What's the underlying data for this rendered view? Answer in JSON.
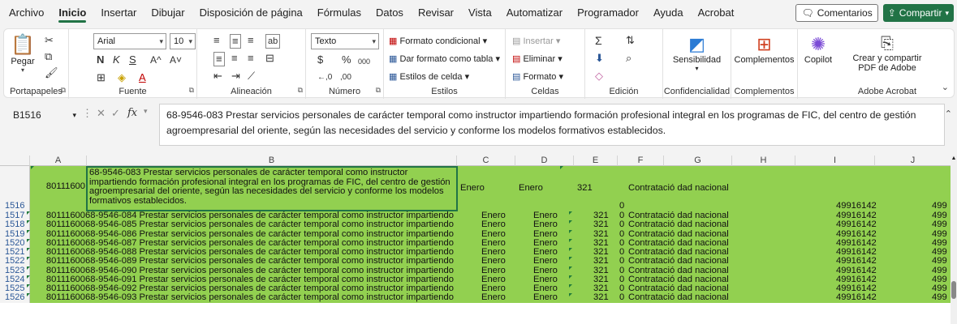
{
  "menu": {
    "items": [
      "Archivo",
      "Inicio",
      "Insertar",
      "Dibujar",
      "Disposición de página",
      "Fórmulas",
      "Datos",
      "Revisar",
      "Vista",
      "Automatizar",
      "Programador",
      "Ayuda",
      "Acrobat"
    ],
    "active_index": 1,
    "comments_label": "Comentarios",
    "share_label": "Compartir"
  },
  "ribbon": {
    "clipboard": {
      "label": "Portapapeles",
      "paste": "Pegar"
    },
    "font": {
      "label": "Fuente",
      "name": "Arial",
      "size": "10",
      "bold": "N",
      "italic": "K",
      "underline": "S",
      "grow": "A^",
      "shrink": "A˅"
    },
    "alignment": {
      "label": "Alineación"
    },
    "number": {
      "label": "Número",
      "format": "Texto",
      "currency": "$",
      "percent": "%",
      "thousands": "000",
      "inc_dec": "←,0",
      "dec_dec": ",00"
    },
    "styles": {
      "label": "Estilos",
      "conditional": "Formato condicional",
      "table": "Dar formato como tabla",
      "cell_styles": "Estilos de celda"
    },
    "cells": {
      "label": "Celdas",
      "insert": "Insertar",
      "delete": "Eliminar",
      "format": "Formato"
    },
    "editing": {
      "label": "Edición",
      "sum": "Σ"
    },
    "sensitivity": {
      "label": "Confidencialidad",
      "button": "Sensibilidad"
    },
    "addins": {
      "label": "Complementos",
      "button": "Complementos"
    },
    "copilot": {
      "button": "Copilot"
    },
    "acrobat": {
      "label": "Adobe Acrobat",
      "button_line1": "Crear y compartir",
      "button_line2": "PDF de Adobe"
    }
  },
  "formula_bar": {
    "name_box": "B1516",
    "fx": "fx",
    "content": "68-9546-083 Prestar servicios personales de carácter temporal como instructor impartiendo formación profesional integral en los programas de FIC, del centro de gestión agroempresarial del oriente, según las necesidades del servicio y conforme los modelos formativos establecidos."
  },
  "columns": [
    "A",
    "B",
    "C",
    "D",
    "E",
    "F",
    "G",
    "H",
    "I",
    "J"
  ],
  "first_row": {
    "number": "1516",
    "a": "80111600",
    "b_lines": [
      "68-9546-083 Prestar servicios personales de carácter temporal como instructor",
      "impartiendo formación profesional integral en los programas de FIC, del centro de gestión",
      "agroempresarial del oriente, según las necesidades del servicio y conforme los modelos",
      "formativos establecidos."
    ],
    "c": "Enero",
    "d": "Enero",
    "e": "321",
    "f": "0",
    "g": "Contratació dad nacional",
    "i": "49916142",
    "j": "499"
  },
  "rows": [
    {
      "num": "1517",
      "a": "80111600",
      "b": "68-9546-084 Prestar servicios personales de carácter temporal como instructor impartiendo",
      "c": "Enero",
      "d": "Enero",
      "e": "321",
      "f": "0",
      "g": "Contratació dad nacional",
      "i": "49916142",
      "j": "499"
    },
    {
      "num": "1518",
      "a": "80111600",
      "b": "68-9546-085 Prestar servicios personales de carácter temporal como instructor impartiendo",
      "c": "Enero",
      "d": "Enero",
      "e": "321",
      "f": "0",
      "g": "Contratació dad nacional",
      "i": "49916142",
      "j": "499"
    },
    {
      "num": "1519",
      "a": "80111600",
      "b": "68-9546-086 Prestar servicios personales de carácter temporal como instructor impartiendo",
      "c": "Enero",
      "d": "Enero",
      "e": "321",
      "f": "0",
      "g": "Contratació dad nacional",
      "i": "49916142",
      "j": "499"
    },
    {
      "num": "1520",
      "a": "80111600",
      "b": "68-9546-087 Prestar servicios personales de carácter temporal como instructor impartiendo",
      "c": "Enero",
      "d": "Enero",
      "e": "321",
      "f": "0",
      "g": "Contratació dad nacional",
      "i": "49916142",
      "j": "499"
    },
    {
      "num": "1521",
      "a": "80111600",
      "b": "68-9546-088 Prestar servicios personales de carácter temporal como instructor impartiendo",
      "c": "Enero",
      "d": "Enero",
      "e": "321",
      "f": "0",
      "g": "Contratació dad nacional",
      "i": "49916142",
      "j": "499"
    },
    {
      "num": "1522",
      "a": "80111600",
      "b": "68-9546-089 Prestar servicios personales de carácter temporal como instructor impartiendo",
      "c": "Enero",
      "d": "Enero",
      "e": "321",
      "f": "0",
      "g": "Contratació dad nacional",
      "i": "49916142",
      "j": "499"
    },
    {
      "num": "1523",
      "a": "80111600",
      "b": "68-9546-090 Prestar servicios personales de carácter temporal como instructor impartiendo",
      "c": "Enero",
      "d": "Enero",
      "e": "321",
      "f": "0",
      "g": "Contratació dad nacional",
      "i": "49916142",
      "j": "499"
    },
    {
      "num": "1524",
      "a": "80111600",
      "b": "68-9546-091 Prestar servicios personales de carácter temporal como instructor impartiendo",
      "c": "Enero",
      "d": "Enero",
      "e": "321",
      "f": "0",
      "g": "Contratació dad nacional",
      "i": "49916142",
      "j": "499"
    },
    {
      "num": "1525",
      "a": "80111600",
      "b": "68-9546-092 Prestar servicios personales de carácter temporal como instructor impartiendo",
      "c": "Enero",
      "d": "Enero",
      "e": "321",
      "f": "0",
      "g": "Contratació dad nacional",
      "i": "49916142",
      "j": "499"
    },
    {
      "num": "1526",
      "a": "80111600",
      "b": "68-9546-093 Prestar servicios personales de carácter temporal como instructor impartiendo",
      "c": "Enero",
      "d": "Enero",
      "e": "321",
      "f": "0",
      "g": "Contratació dad nacional",
      "i": "49916142",
      "j": "499"
    }
  ],
  "colors": {
    "accent": "#217346",
    "row_fill": "#92d050",
    "row_number": "#2b5797"
  }
}
